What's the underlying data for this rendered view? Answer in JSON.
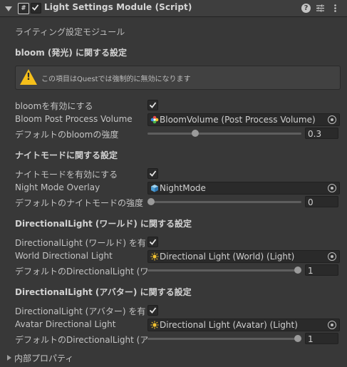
{
  "header": {
    "title": "Light Settings Module (Script)",
    "enabled": true,
    "help_label": "?"
  },
  "subtitle": "ライティング設定モジュール",
  "bloom": {
    "heading": "bloom (発光) に関する設定",
    "warning": "この項目はQuestでは強制的に無効になります",
    "enable_label": "bloomを有効にする",
    "enable_checked": true,
    "volume_label": "Bloom Post Process Volume",
    "volume_value": "BloomVolume (Post Process Volume)",
    "intensity_label": "デフォルトのbloomの強度",
    "intensity_value": "0.3",
    "intensity_fraction": 0.3
  },
  "night": {
    "heading": "ナイトモードに関する設定",
    "enable_label": "ナイトモードを有効にする",
    "enable_checked": true,
    "overlay_label": "Night Mode Overlay",
    "overlay_value": "NightMode",
    "intensity_label": "デフォルトのナイトモードの強度",
    "intensity_value": "0",
    "intensity_fraction": 0
  },
  "world_light": {
    "heading": "DirectionalLight (ワールド) に関する設定",
    "enable_label": "DirectionalLight (ワールド) を有効にする",
    "enable_checked": true,
    "light_label": "World Directional Light",
    "light_value": "Directional Light (World) (Light)",
    "intensity_label": "デフォルトのDirectionalLight (ワールド) の強度",
    "intensity_value": "1",
    "intensity_fraction": 1
  },
  "avatar_light": {
    "heading": "DirectionalLight (アバター) に関する設定",
    "enable_label": "DirectionalLight (アバター) を有効にする",
    "enable_checked": true,
    "light_label": "Avatar Directional Light",
    "light_value": "Directional Light (Avatar) (Light)",
    "intensity_label": "デフォルトのDirectionalLight (アバター) の強度",
    "intensity_value": "1",
    "intensity_fraction": 1
  },
  "internal": {
    "label": "内部プロパティ"
  },
  "colors": {
    "background": "#383838",
    "warning": "#f5bf1a",
    "field": "#2a2a2a"
  }
}
